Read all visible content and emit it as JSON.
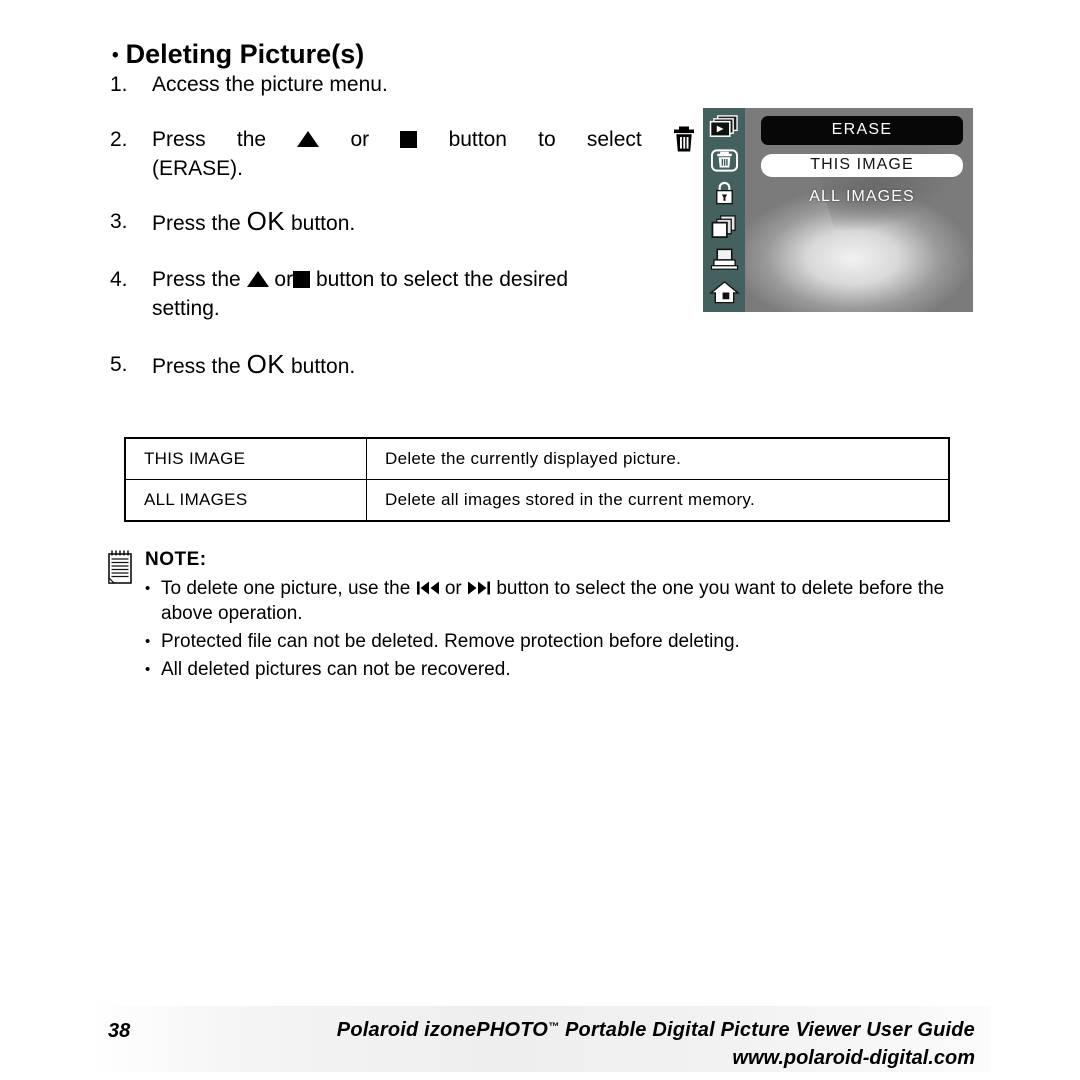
{
  "heading": {
    "bullet": "•",
    "title": "Deleting Picture(s)"
  },
  "steps": [
    {
      "num": "1.",
      "text": "Access the picture menu."
    },
    {
      "num": "2.",
      "pre": "Press the",
      "icon_a": "up-triangle",
      "mid": "or",
      "icon_b": "down-square",
      "post": "button to select",
      "icon_c": "trash-icon",
      "line2": "(ERASE)."
    },
    {
      "num": "3.",
      "pre": "Press the",
      "ok": "OK",
      "post": "button."
    },
    {
      "num": "4.",
      "pre": "Press the",
      "icon_a": "up-triangle",
      "mid": "or",
      "icon_b": "down-square",
      "post": "button to select the desired",
      "line2": "setting."
    },
    {
      "num": "5.",
      "pre": "Press the",
      "ok": "OK",
      "post": "button."
    }
  ],
  "lcd": {
    "sidebar_icons": [
      "slideshow-icon",
      "trash-icon",
      "lock-icon",
      "copy-icon",
      "print-icon",
      "home-icon"
    ],
    "menu_title": "ERASE",
    "options": [
      {
        "label": "THIS IMAGE",
        "selected": true
      },
      {
        "label": "ALL IMAGES",
        "selected": false
      }
    ],
    "sidebar_color": "#44605f",
    "title_bg": "#070707",
    "title_fg": "#ffffff"
  },
  "table": {
    "rows": [
      {
        "option": "THIS IMAGE",
        "description": "Delete the currently displayed picture."
      },
      {
        "option": "ALL IMAGES",
        "description": "Delete all images stored in the current memory."
      }
    ]
  },
  "note": {
    "icon": "notepad-icon",
    "title": "NOTE:",
    "bullet": "•",
    "items": [
      {
        "pre": "To delete one picture, use the",
        "icon_a": "skip-backward-icon",
        "mid": "or",
        "icon_b": "skip-forward-icon",
        "post": "button to select the one you want to delete before the above operation."
      },
      {
        "text": "Protected file can not be deleted. Remove protection before deleting."
      },
      {
        "text": "All deleted pictures can not be recovered."
      }
    ]
  },
  "footer": {
    "page_number": "38",
    "title": "Polaroid izonePHOTO",
    "trademark": "™",
    "title_rest": " Portable Digital Picture Viewer User Guide",
    "url": "www.polaroid-digital.com"
  }
}
